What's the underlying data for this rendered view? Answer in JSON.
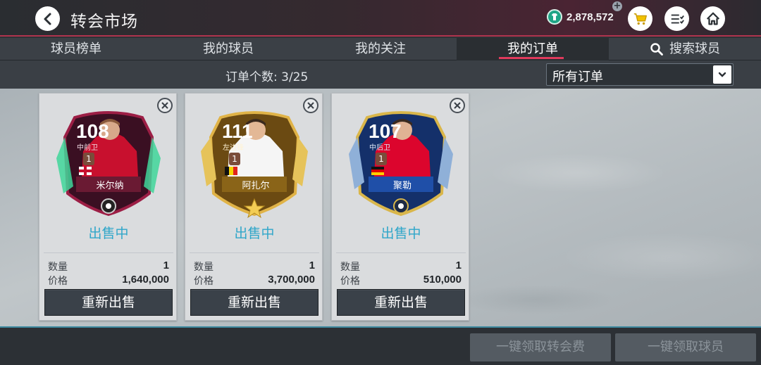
{
  "header": {
    "title": "转会市场",
    "coins": "2,878,572",
    "plus": "+"
  },
  "tabs": [
    {
      "label": "球员榜单"
    },
    {
      "label": "我的球员"
    },
    {
      "label": "我的关注"
    },
    {
      "label": "我的订单",
      "active": true
    },
    {
      "label": "搜索球员"
    }
  ],
  "subbar": {
    "order_count_label": "订单个数:",
    "order_count_value": "3/25",
    "filter_selected": "所有订单"
  },
  "cards": [
    {
      "rating": "108",
      "position": "中前卫",
      "rank_badge": "1",
      "name": "米尔纳",
      "status": "出售中",
      "qty_label": "数量",
      "qty": "1",
      "price_label": "价格",
      "price": "1,640,000",
      "resell_label": "重新出售",
      "theme": "#9c1e45",
      "flag": "england",
      "kit": "#c8102e"
    },
    {
      "rating": "111",
      "position": "左边锋",
      "rank_badge": "1",
      "name": "阿扎尔",
      "status": "出售中",
      "qty_label": "数量",
      "qty": "1",
      "price_label": "价格",
      "price": "3,700,000",
      "resell_label": "重新出售",
      "theme": "#c69324",
      "flag": "belgium",
      "kit": "#f5f5f5"
    },
    {
      "rating": "107",
      "position": "中后卫",
      "rank_badge": "1",
      "name": "聚勒",
      "status": "出售中",
      "qty_label": "数量",
      "qty": "1",
      "price_label": "价格",
      "price": "510,000",
      "resell_label": "重新出售",
      "theme": "#1f4fa8",
      "flag": "germany",
      "kit": "#dc052d"
    }
  ],
  "footer": {
    "claim_fees": "一键领取转会费",
    "claim_players": "一键领取球员"
  },
  "colors": {
    "accent": "#e03a5c",
    "status": "#2fa6c9",
    "coin": "#1fa586"
  }
}
